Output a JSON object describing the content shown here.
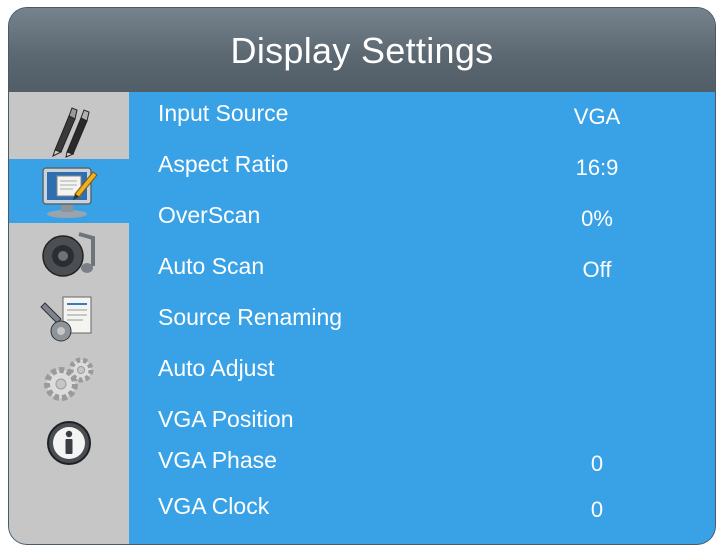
{
  "header": {
    "title": "Display Settings"
  },
  "sidebar": {
    "items": [
      {
        "icon": "pens-icon",
        "active": false
      },
      {
        "icon": "monitor-icon",
        "active": true
      },
      {
        "icon": "speaker-icon",
        "active": false
      },
      {
        "icon": "tools-icon",
        "active": false
      },
      {
        "icon": "gears-icon",
        "active": false
      },
      {
        "icon": "info-icon",
        "active": false
      }
    ]
  },
  "menu": {
    "rows": [
      {
        "label": "Input Source",
        "value": "VGA"
      },
      {
        "label": "Aspect Ratio",
        "value": "16:9"
      },
      {
        "label": "OverScan",
        "value": "0%"
      },
      {
        "label": "Auto Scan",
        "value": "Off"
      },
      {
        "label": "Source Renaming",
        "value": ""
      },
      {
        "label": "Auto Adjust",
        "value": ""
      },
      {
        "label": "VGA Position",
        "value": ""
      },
      {
        "label": "VGA Phase",
        "value": "0"
      },
      {
        "label": "VGA Clock",
        "value": "0"
      }
    ]
  },
  "colors": {
    "accent": "#39a2e6",
    "title_bar": "#5a6670",
    "sidebar": "#c6c6c6",
    "text": "#ffffff"
  }
}
